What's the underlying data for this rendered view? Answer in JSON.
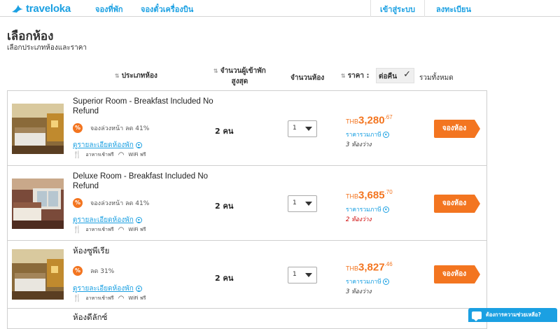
{
  "brand": {
    "name": "traveloka",
    "color": "#1ba0e2"
  },
  "nav": {
    "hotel": "จองที่พัก",
    "flight": "จองตั๋วเครื่องบิน",
    "login": "เข้าสู่ระบบ",
    "register": "ลงทะเบียน"
  },
  "page": {
    "title": "เลือกห้อง",
    "subtitle": "เลือกประเภทห้องและราคา"
  },
  "columns": {
    "room_type": "ประเภทห้อง",
    "max_guests_1": "จำนวนผู้เข้าพัก",
    "max_guests_2": "สูงสุด",
    "num_rooms": "จำนวนห้อง",
    "price": "ราคา :",
    "per_night": "ต่อคืน",
    "total": "รวมทั้งหมด"
  },
  "rooms": [
    {
      "name": "Superior Room - Breakfast Included No Refund",
      "promo": "จองล่วงหน้า ลด 41%",
      "details": "ดูรายละเอียดห้องพัก",
      "breakfast": "อาหารเช้าฟรี",
      "wifi": "WiFi ฟรี",
      "guests": "2 คน",
      "qty": "1",
      "currency": "THB",
      "price_main": "3,280",
      "price_dec": ".67",
      "tax_note": "ราคารวมภาษี",
      "availability": "3 ห้องว่าง",
      "book": "จองห้อง"
    },
    {
      "name": "Deluxe Room - Breakfast Included No Refund",
      "promo": "จองล่วงหน้า ลด 41%",
      "details": "ดูรายละเอียดห้องพัก",
      "breakfast": "อาหารเช้าฟรี",
      "wifi": "WiFi ฟรี",
      "guests": "2 คน",
      "qty": "1",
      "currency": "THB",
      "price_main": "3,685",
      "price_dec": ".70",
      "tax_note": "ราคารวมภาษี",
      "availability": "2 ห้องว่าง",
      "book": "จองห้อง"
    },
    {
      "name": "ห้องซูพีเรีย",
      "promo": "ลด 31%",
      "details": "ดูรายละเอียดห้องพัก",
      "breakfast": "อาหารเช้าฟรี",
      "wifi": "WiFi ฟรี",
      "guests": "2 คน",
      "qty": "1",
      "currency": "THB",
      "price_main": "3,827",
      "price_dec": ".46",
      "tax_note": "ราคารวมภาษี",
      "availability": "3 ห้องว่าง",
      "book": "จองห้อง"
    },
    {
      "name": "ห้องดีลักซ์"
    }
  ],
  "help": {
    "label": "ต้องการความช่วยเหลือ?"
  },
  "colors": {
    "accent": "#f37520",
    "link": "#1ba0e2",
    "warning": "#cc0000"
  }
}
